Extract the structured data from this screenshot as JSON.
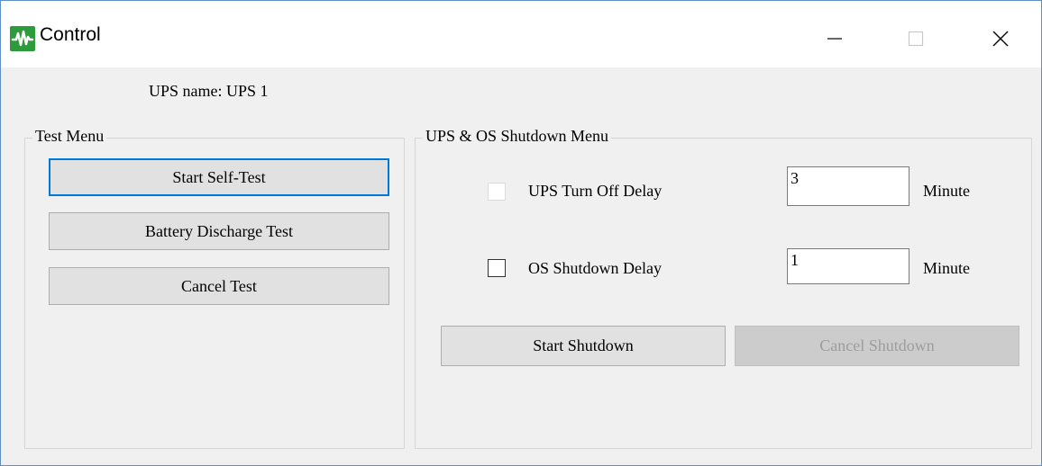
{
  "window": {
    "title": "Control",
    "controls": {
      "minimize": "minimize",
      "maximize": "maximize",
      "close": "close"
    }
  },
  "ups_name_label": "UPS name:  UPS 1",
  "test_menu": {
    "caption": "Test Menu",
    "buttons": {
      "self_test": "Start Self-Test",
      "battery_discharge": "Battery Discharge Test",
      "cancel_test": "Cancel Test"
    }
  },
  "shutdown_menu": {
    "caption": "UPS & OS Shutdown Menu",
    "ups_turn_off": {
      "label": "UPS Turn Off Delay",
      "value": "3",
      "unit": "Minute",
      "checked": false,
      "enabled": false
    },
    "os_shutdown": {
      "label": "OS Shutdown Delay",
      "value": "1",
      "unit": "Minute",
      "checked": false,
      "enabled": true
    },
    "buttons": {
      "start_shutdown": "Start Shutdown",
      "cancel_shutdown": "Cancel Shutdown"
    }
  },
  "colors": {
    "app_icon": "#2d9b3c",
    "focus_border": "#0078d7",
    "window_border": "#5f8fc4"
  },
  "icons": {
    "app": "waveform-icon",
    "minimize": "minimize-icon",
    "maximize": "maximize-icon",
    "close": "close-icon"
  }
}
